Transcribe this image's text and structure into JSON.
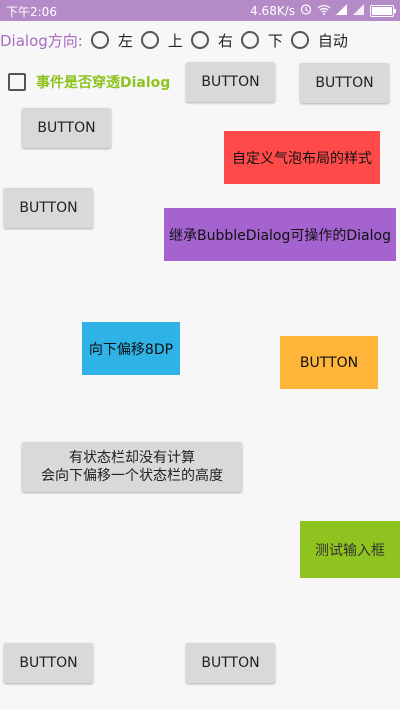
{
  "status_bar": {
    "time": "下午2:06",
    "speed": "4.68K/s",
    "icons": [
      "alarm-icon",
      "wifi-icon",
      "signal-icon",
      "signal-icon",
      "battery-icon"
    ],
    "battery_level": 1.0
  },
  "direction": {
    "label": "Dialog方向:",
    "options": [
      "左",
      "上",
      "右",
      "下",
      "自动"
    ]
  },
  "penetrate": {
    "label": "事件是否穿透Dialog",
    "checked": false
  },
  "buttons": {
    "top_mid": "BUTTON",
    "top_right": "BUTTON",
    "left_1": "BUTTON",
    "left_2": "BUTTON",
    "custom_style": "自定义气泡布局的样式",
    "inherit": "继承BubbleDialog可操作的Dialog",
    "offset_8dp": "向下偏移8DP",
    "orange": "BUTTON",
    "statusbar_line1": "有状态栏却没有计算",
    "statusbar_line2": "会向下偏移一个状态栏的高度",
    "input_test": "测试输入框",
    "bottom_left": "BUTTON",
    "bottom_mid": "BUTTON"
  },
  "colors": {
    "status_bar": "#b58bc7",
    "accent_purple": "#a76bbf",
    "accent_green": "#8fc31f",
    "red": "#ff4a4a",
    "purple": "#a463cf",
    "blue": "#2fb3e6",
    "orange": "#ffb53a",
    "green": "#8fc31f"
  }
}
